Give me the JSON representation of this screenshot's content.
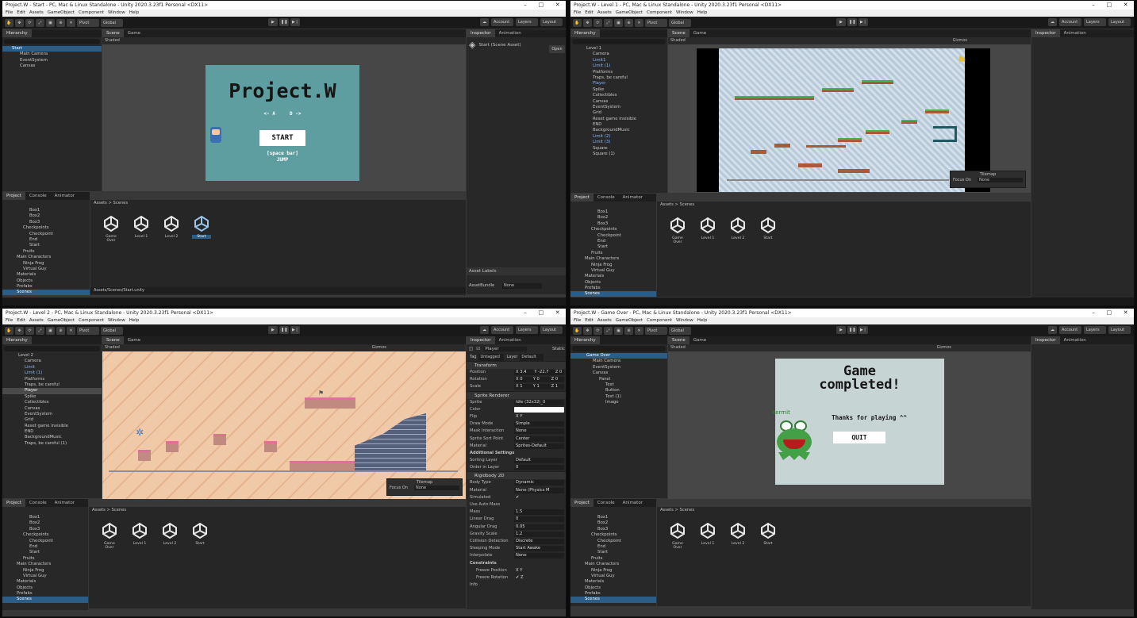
{
  "menu": [
    "File",
    "Edit",
    "Assets",
    "GameObject",
    "Component",
    "Window",
    "Help"
  ],
  "toolbar": {
    "pivot": "Pivot",
    "global": "Global",
    "account": "Account",
    "layers": "Layers",
    "layout": "Layout"
  },
  "tabs": {
    "hierarchy": "Hierarchy",
    "scene": "Scene",
    "game": "Game",
    "project": "Project",
    "console": "Console",
    "animator": "Animator",
    "inspector": "Inspector",
    "animation": "Animation",
    "tilemap": "Tilemap",
    "focus_on": "Focus On",
    "none": "None",
    "shaded": "Shaded",
    "gizmos": "Gizmos",
    "all": "All",
    "assets": "Assets",
    "scenes": "Scenes"
  },
  "project_tree": [
    "Box1",
    "Box2",
    "Box3",
    "Checkpoints",
    "Checkpoint",
    "End",
    "Start",
    "Fruits",
    "Main Characters",
    "Ninja Frog",
    "Virtual Guy",
    "Materials",
    "Objects",
    "Prefabs",
    "Scenes"
  ],
  "scene_assets": [
    "Game Over",
    "Level 1",
    "Level 2",
    "Start"
  ],
  "win1": {
    "title": "Project.W - Start - PC, Mac & Linux Standalone - Unity 2020.3.23f1 Personal <DX11>",
    "hierarchy": [
      "Start",
      "Main Camera",
      "EventSystem",
      "Canvas"
    ],
    "game_title": "Project.W",
    "keys": "<- A     D ->",
    "start": "START",
    "space": "[space bar]",
    "jump": "JUMP",
    "inspector_title": "Start (Scene Asset)",
    "open": "Open",
    "asset_labels": "Asset Labels",
    "asset_bundle": "AssetBundle",
    "path": "Assets/Scenes/Start.unity"
  },
  "win2": {
    "title": "Project.W - Level 1 - PC, Mac & Linux Standalone - Unity 2020.3.23f1 Personal <DX11>",
    "hierarchy": [
      "Level 1",
      "Camera",
      "Limit1",
      "Limit (1)",
      "Platforms",
      "Traps, be careful",
      "Player",
      "Spike",
      "Collectibles",
      "Canvas",
      "EventSystem",
      "Grid",
      "Reset game invisible",
      "END",
      "BackgroundMusic",
      "Limit (2)",
      "Limit (3)",
      "Square",
      "Square (1)"
    ]
  },
  "win3": {
    "title": "Project.W - Level 2 - PC, Mac & Linux Standalone - Unity 2020.3.23f1 Personal <DX11>",
    "hierarchy": [
      "Level 2",
      "Camera",
      "Limit",
      "Limit (1)",
      "Platforms",
      "Traps, be careful",
      "Player",
      "Spike",
      "Collectibles",
      "Canvas",
      "EventSystem",
      "Grid",
      "Reset game invisible",
      "END",
      "BackgroundMusic",
      "Traps, be careful (1)"
    ],
    "inspector": {
      "name": "Player",
      "static": "Static",
      "tag": "Tag",
      "tag_value": "Untagged",
      "layer": "Layer",
      "layer_value": "Default",
      "transform": "Transform",
      "position": "Position",
      "pos": "X 3.4      Y -22.7     Z 0",
      "rotation": "Rotation",
      "rot": "X 0        Y 0         Z 0",
      "scale": "Scale",
      "scl": "X 1        Y 1         Z 1",
      "sprite_renderer": "Sprite Renderer",
      "rows1": [
        [
          "Sprite",
          "Idle (32x32)_0"
        ],
        [
          "Color",
          ""
        ],
        [
          "Flip",
          "X   Y"
        ],
        [
          "Draw Mode",
          "Simple"
        ],
        [
          "Mask Interaction",
          "None"
        ],
        [
          "Sprite Sort Point",
          "Center"
        ],
        [
          "Material",
          "Sprites-Default"
        ]
      ],
      "additional": "Additional Settings",
      "rows2": [
        [
          "Sorting Layer",
          "Default"
        ],
        [
          "Order in Layer",
          "0"
        ]
      ],
      "rigidbody": "Rigidbody 2D",
      "rows3": [
        [
          "Body Type",
          "Dynamic"
        ],
        [
          "Material",
          "None (Physics M"
        ],
        [
          "Simulated",
          "✔"
        ],
        [
          "Use Auto Mass",
          ""
        ],
        [
          "Mass",
          "1.5"
        ],
        [
          "Linear Drag",
          "0"
        ],
        [
          "Angular Drag",
          "0.05"
        ],
        [
          "Gravity Scale",
          "1.2"
        ],
        [
          "Collision Detection",
          "Discrete"
        ],
        [
          "Sleeping Mode",
          "Start Awake"
        ],
        [
          "Interpolate",
          "None"
        ]
      ],
      "constraints": "Constraints",
      "rows4": [
        [
          "Freeze Position",
          "X   Y"
        ],
        [
          "Freeze Rotation",
          "✔ Z"
        ]
      ],
      "info": "Info"
    }
  },
  "win4": {
    "title": "Project.W - Game Over - PC, Mac & Linux Standalone - Unity 2020.3.23f1 Personal <DX11>",
    "hierarchy": [
      "Game Over",
      "Main Camera",
      "EventSystem",
      "Canvas",
      "Panel",
      "Text",
      "Button",
      "Text (1)",
      "Image"
    ],
    "line1": "Game",
    "line2": "completed!",
    "thanks": "Thanks for playing ^^",
    "quit": "QUIT",
    "kermit": "Kermit"
  },
  "colors": {
    "selection": "#2c5d87",
    "panel": "#282828",
    "title_bg": "#5f9ea0",
    "gameover_bg": "#c7d4d4",
    "level2_bg": "#f0c9a8"
  }
}
